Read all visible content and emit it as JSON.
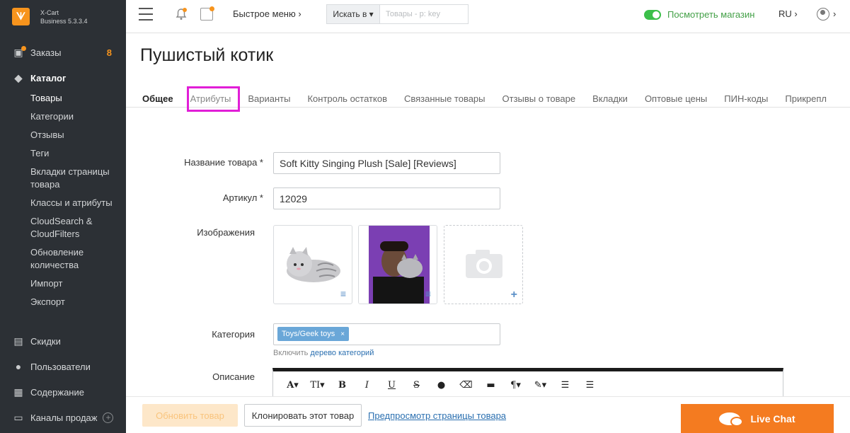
{
  "brand": {
    "name_line1": "X-Cart",
    "name_line2": "Business 5.3.3.4"
  },
  "sidebar": {
    "orders": {
      "label": "Заказы",
      "count": "8"
    },
    "catalog": {
      "label": "Каталог"
    },
    "catalog_items": [
      "Товары",
      "Категории",
      "Отзывы",
      "Теги",
      "Вкладки страницы товара",
      "Классы и атрибуты",
      "CloudSearch & CloudFilters",
      "Обновление количества",
      "Импорт",
      "Экспорт"
    ],
    "bottom": {
      "discounts": "Скидки",
      "users": "Пользователи",
      "content": "Содержание",
      "sales_channels": "Каналы продаж"
    }
  },
  "header": {
    "quick_menu": "Быстрое меню ›",
    "search_in": "Искать в ▾",
    "search_placeholder": "Товары - p: key",
    "view_store": "Посмотреть магазин",
    "lang": "RU ›",
    "user_caret": "›"
  },
  "page": {
    "title": "Пушистый котик"
  },
  "tabs": [
    "Общее",
    "Атрибуты",
    "Варианты",
    "Контроль остатков",
    "Связанные товары",
    "Отзывы о товаре",
    "Вкладки",
    "Оптовые цены",
    "ПИН-коды",
    "Прикрепл"
  ],
  "form": {
    "name_label": "Название товара *",
    "name_value": "Soft Kitty Singing Plush [Sale] [Reviews]",
    "sku_label": "Артикул *",
    "sku_value": "12029",
    "images_label": "Изображения",
    "category_label": "Категория",
    "category_tag": "Toys/Geek toys",
    "category_hint_prefix": "Включить",
    "category_hint_link": "дерево категорий",
    "description_label": "Описание"
  },
  "footer": {
    "update": "Обновить товар",
    "clone": "Клонировать этот товар",
    "preview": "Предпросмотр страницы товара",
    "live_chat": "Live Chat"
  },
  "colors": {
    "accent": "#f7941d",
    "highlight": "#e11ed7",
    "sidebar_bg": "#2c3035",
    "link": "#2a6fb0",
    "store_green": "#43a047"
  }
}
